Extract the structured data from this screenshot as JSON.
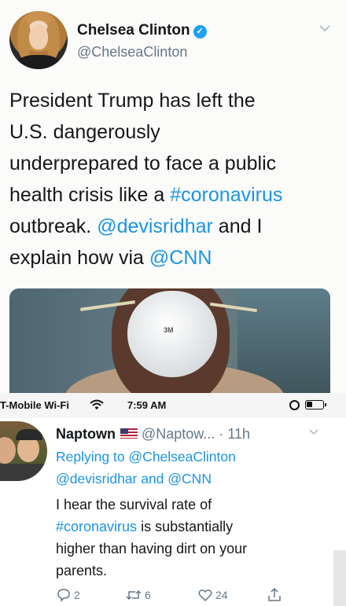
{
  "tweet": {
    "author_name": "Chelsea Clinton",
    "author_handle": "@ChelseaClinton",
    "verified": true,
    "text_lines": [
      [
        {
          "t": "President Trump has left the"
        }
      ],
      [
        {
          "t": "U.S. dangerously"
        }
      ],
      [
        {
          "t": "underprepared to face a public"
        }
      ],
      [
        {
          "t": "health crisis like a "
        },
        {
          "t": "#coronavirus",
          "link": true
        }
      ],
      [
        {
          "t": "outbreak. "
        },
        {
          "t": "@devisridhar",
          "link": true
        },
        {
          "t": " and I"
        }
      ],
      [
        {
          "t": "explain how via "
        },
        {
          "t": "@CNN",
          "link": true
        }
      ]
    ],
    "media_logo": "3M",
    "menu_icon": "chevron-down-icon"
  },
  "status_bar": {
    "carrier": "T-Mobile Wi-Fi",
    "time": "7:59 AM"
  },
  "reply": {
    "author_name": "Naptown",
    "author_handle": "@Naptow...",
    "time_ago": "· 11h",
    "replying_line1": "Replying to @ChelseaClinton",
    "replying_line2": "@devisridhar and @CNN",
    "text_lines": [
      "I hear the survival rate of",
      "#coronavirus is substantially",
      "higher than having dirt on your",
      "parents."
    ],
    "reply_count": "2",
    "retweet_count": "6",
    "like_count": "24"
  },
  "colors": {
    "link": "#1b95e0",
    "muted": "#657786",
    "verified": "#1da1f2"
  }
}
